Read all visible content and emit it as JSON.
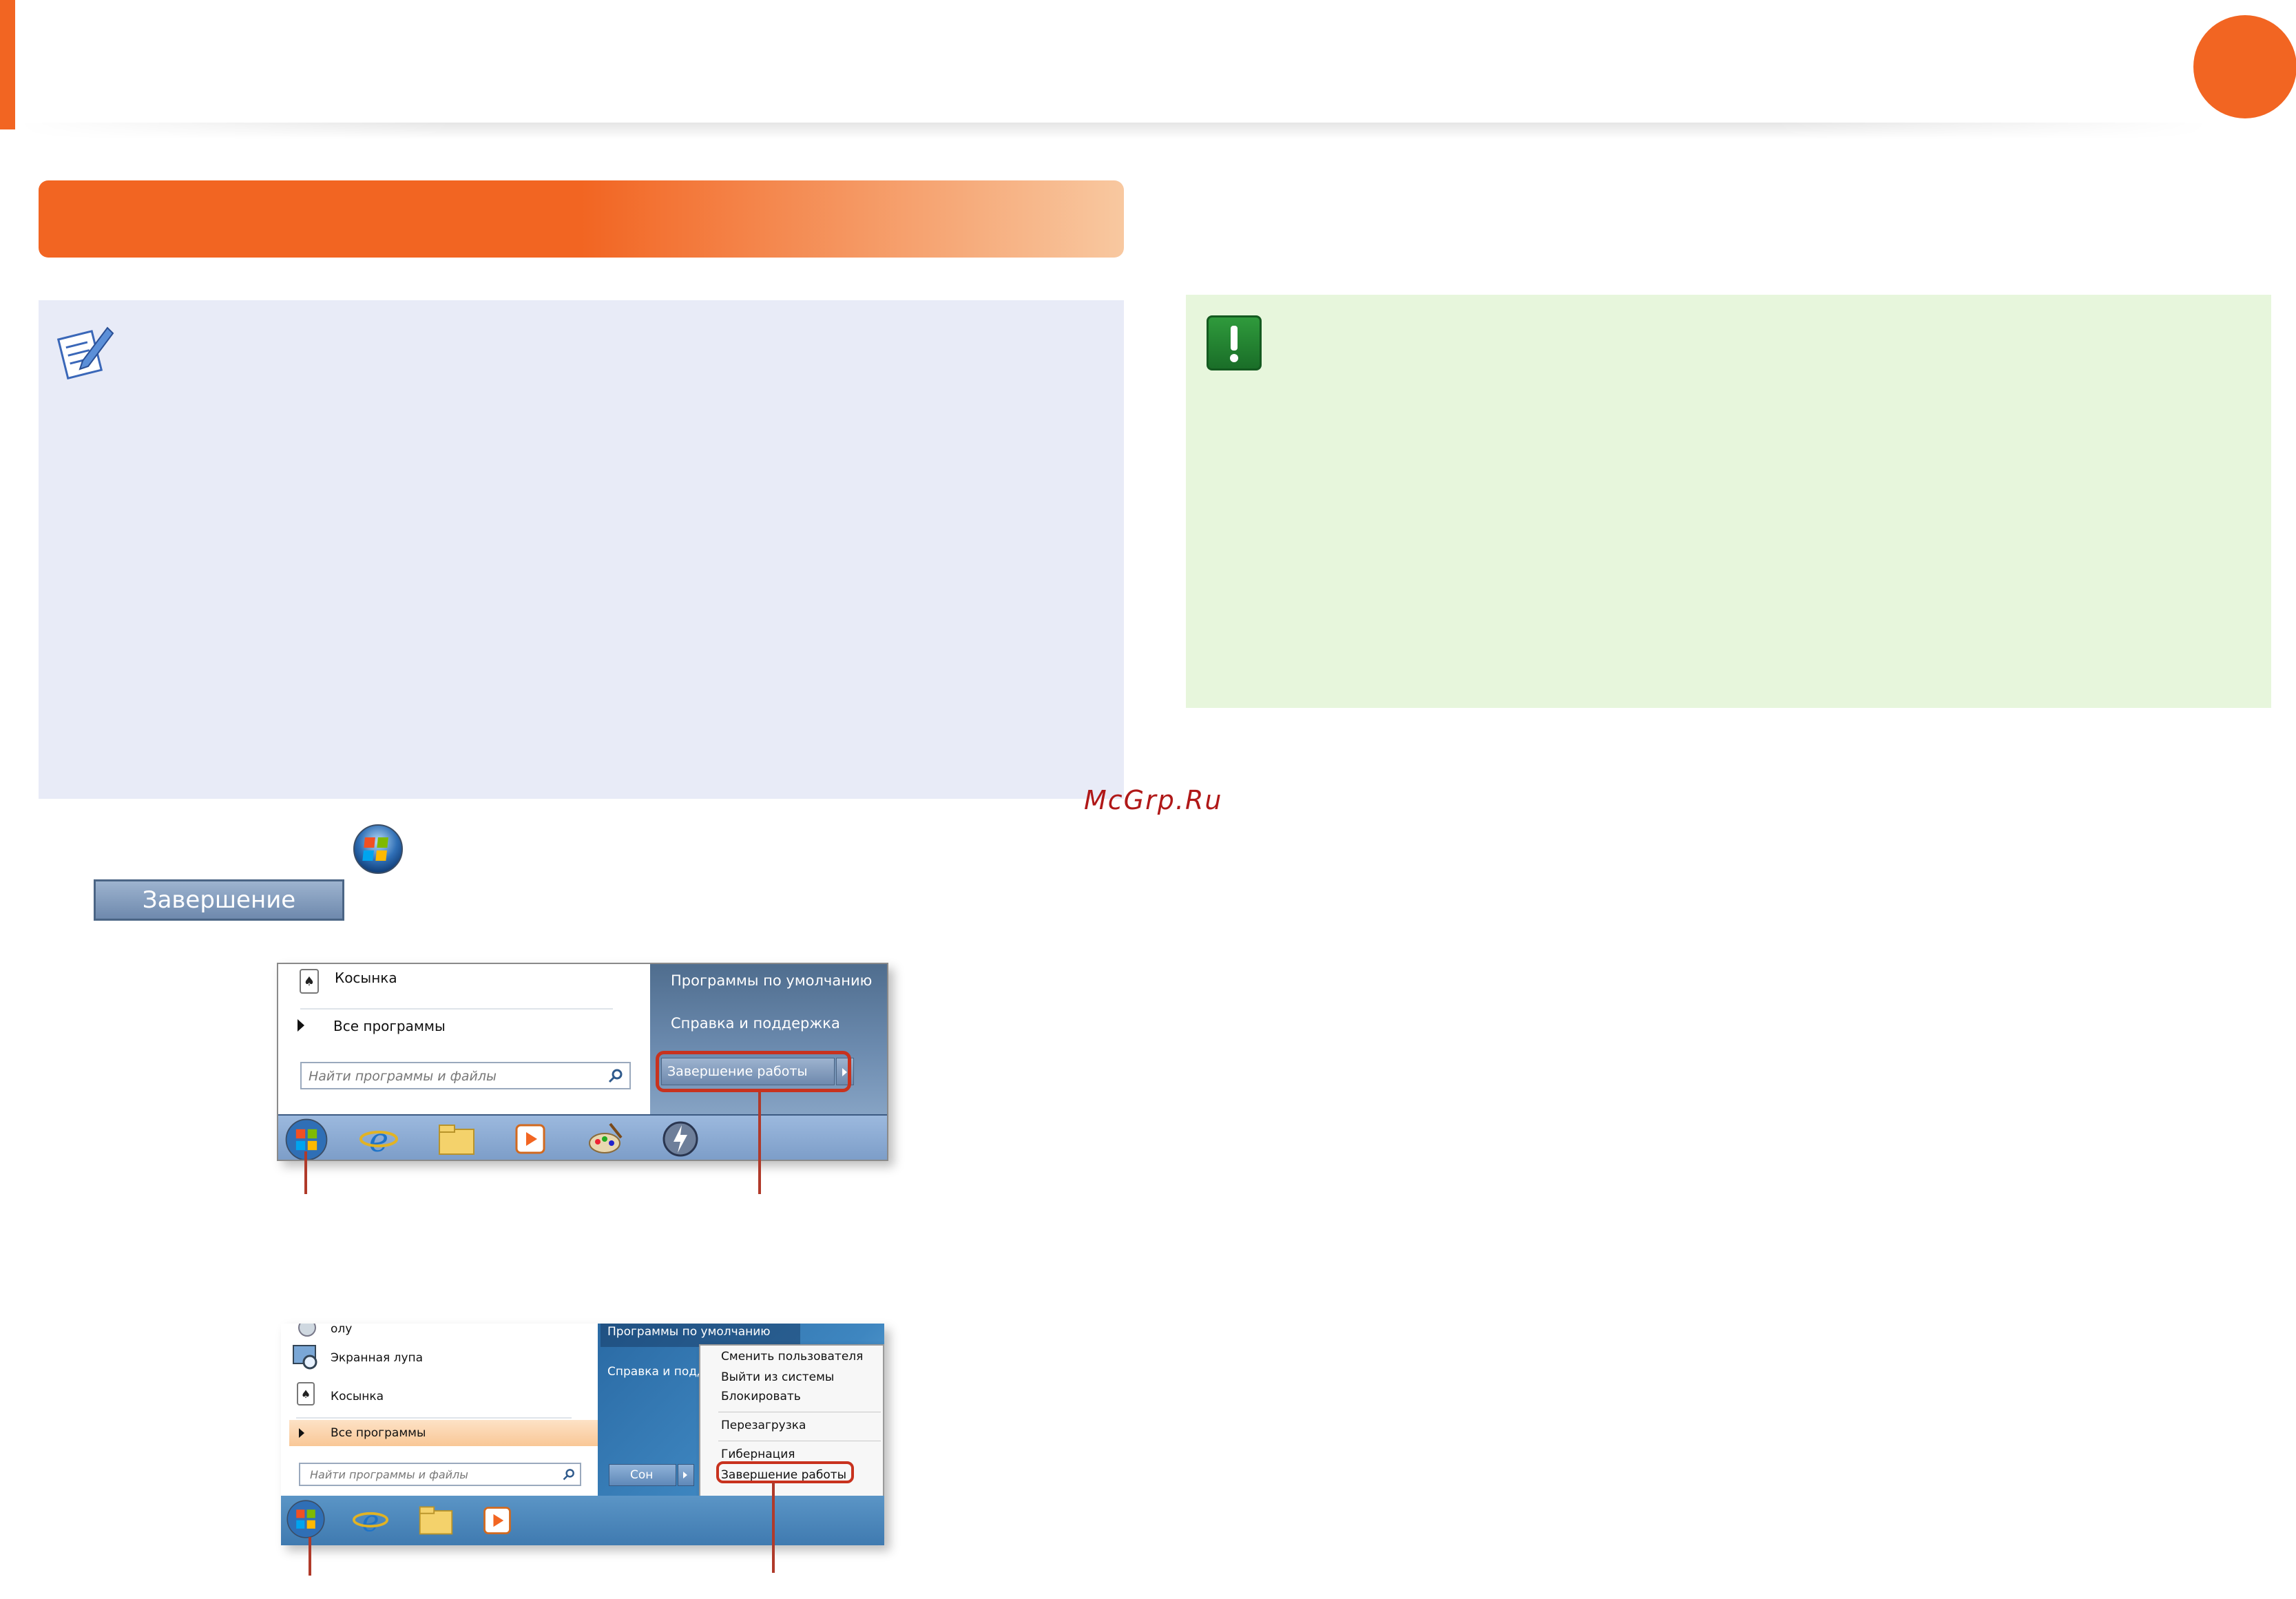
{
  "watermark": "McGrp.Ru",
  "inline": {
    "shutdown_button": "Завершение работы"
  },
  "screenshot1": {
    "app_solitaire": "Косынка",
    "all_programs": "Все программы",
    "search_placeholder": "Найти программы и файлы",
    "default_programs": "Программы по умолчанию",
    "help_support": "Справка и поддержка",
    "shutdown_button": "Завершение работы"
  },
  "screenshot2": {
    "app_top_partial": "олу",
    "app_magnifier": "Экранная лупа",
    "app_solitaire": "Косынка",
    "all_programs": "Все программы",
    "search_placeholder": "Найти программы и файлы",
    "default_programs": "Программы по умолчанию",
    "help_partial": "Справка и подд",
    "sleep_button": "Сон",
    "submenu": {
      "switch_user": "Сменить пользователя",
      "log_off": "Выйти из системы",
      "lock": "Блокировать",
      "restart": "Перезагрузка",
      "hibernate": "Гибернация",
      "shutdown": "Завершение работы"
    }
  },
  "colors": {
    "accent_orange": "#f26522",
    "note_bg": "#e8ebf7",
    "warning_bg": "#e7f6dc",
    "warning_green": "#2f9a3c",
    "highlight_red": "#c8321e"
  }
}
